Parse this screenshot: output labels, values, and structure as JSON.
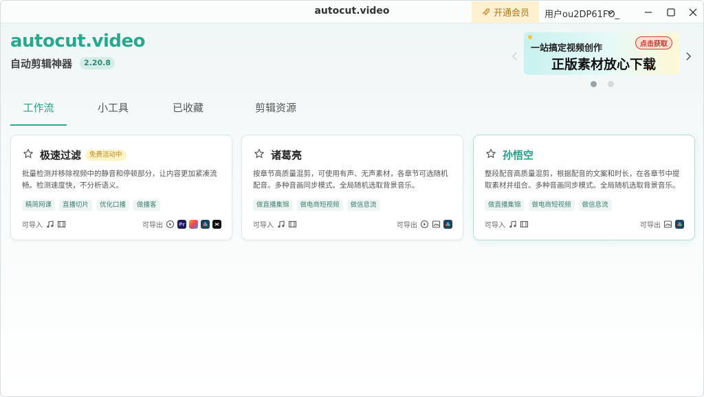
{
  "window": {
    "title": "autocut.video",
    "vip_label": "开通会员",
    "user_name": "用户ou2DP61FO_"
  },
  "brand": {
    "title": "autocut.video",
    "subtitle": "自动剪辑神器",
    "version": "2.20.8"
  },
  "banner": {
    "line1": "一站搞定视频创作",
    "line2": "正版素材放心下载",
    "tag": "点击获取",
    "slide_count": 2,
    "active_slide": 1
  },
  "tabs": [
    {
      "label": "工作流",
      "active": true
    },
    {
      "label": "小工具",
      "active": false
    },
    {
      "label": "已收藏",
      "active": false
    },
    {
      "label": "剪辑资源",
      "active": false
    }
  ],
  "cards": [
    {
      "name": "极速过滤",
      "badge": "免费活动中",
      "desc": "批量检测并移除视频中的静音和停顿部分，让内容更加紧凑流畅。检测速度快，不分析语义。",
      "tags": [
        "精简网课",
        "直播切片",
        "优化口播",
        "做播客"
      ],
      "import_label": "可导入",
      "export_label": "可导出",
      "exports": [
        "play",
        "premiere",
        "multicolor",
        "davinci",
        "capcut"
      ]
    },
    {
      "name": "诸葛亮",
      "badge": "",
      "desc": "按章节高质量混剪，可使用有声、无声素材，各章节可选随机配音。多种音画同步模式。全局随机选取背景音乐。",
      "tags": [
        "做直播集锦",
        "做电商短视频",
        "做信息流"
      ],
      "import_label": "可导入",
      "export_label": "可导出",
      "exports": [
        "play",
        "image",
        "davinci"
      ]
    },
    {
      "name": "孙悟空",
      "badge": "",
      "desc": "整段配音高质量混剪，根据配音的文案和时长，在各章节中提取素材并组合。多种音画同步模式。全局随机选取背景音乐。",
      "tags": [
        "做直播集锦",
        "做电商短视频",
        "做信息流"
      ],
      "import_label": "可导入",
      "export_label": "可导出",
      "exports": [
        "image",
        "davinci"
      ]
    }
  ],
  "colors": {
    "accent": "#2aa88f",
    "vip_bg": "#fdf1cf",
    "badge_bg": "#fdf3c4"
  }
}
